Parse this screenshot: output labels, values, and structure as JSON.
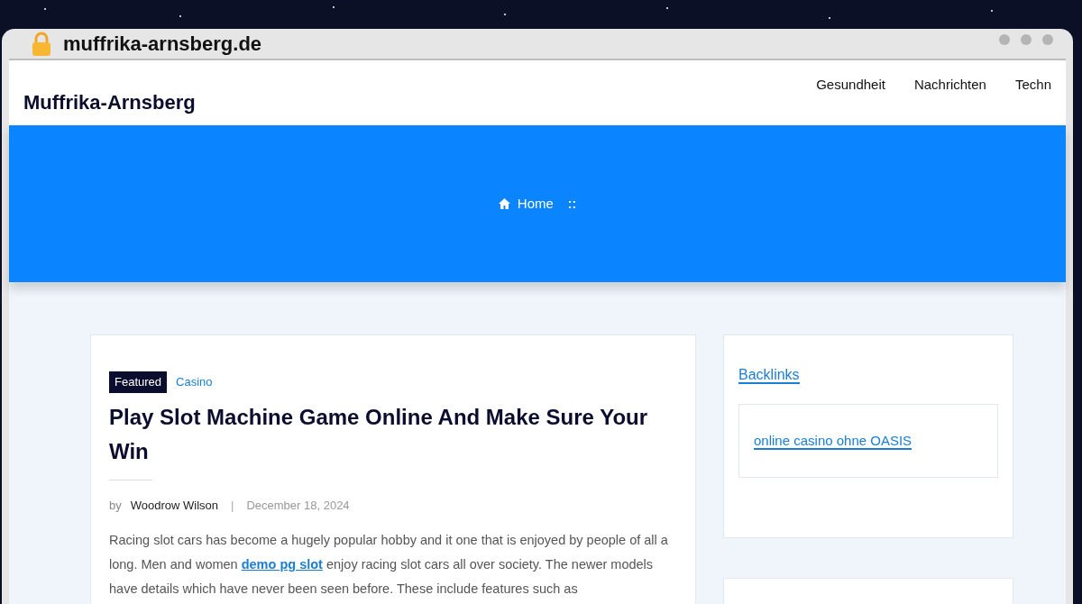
{
  "address_bar": {
    "url": "muffrika-arnsberg.de"
  },
  "header": {
    "site_title": "Muffrika-Arnsberg",
    "nav": [
      "Gesundheit",
      "Nachrichten",
      "Techn"
    ]
  },
  "banner": {
    "breadcrumb": "Home",
    "separator": "::"
  },
  "article": {
    "tags": [
      {
        "label": "Featured",
        "kind": "badge"
      },
      {
        "label": "Casino",
        "kind": "link"
      }
    ],
    "title": "Play Slot Machine Game Online And Make Sure Your Win",
    "by": "by",
    "author": "Woodrow Wilson",
    "meta_separator": "|",
    "date": "December 18, 2024",
    "paragraph": [
      {
        "text": "Racing slot cars has become a hugely popular hobby and it one that is enjoyed by people of all a long. Men and women ",
        "kind": "text"
      },
      {
        "text": "demo pg slot",
        "kind": "link"
      },
      {
        "text": " enjoy racing slot cars all over society. The newer models have details which have never been seen before. These include features such as",
        "kind": "text"
      }
    ]
  },
  "sidebar": {
    "widget_title": "Backlinks",
    "links": [
      "online casino ohne OASIS"
    ]
  }
}
